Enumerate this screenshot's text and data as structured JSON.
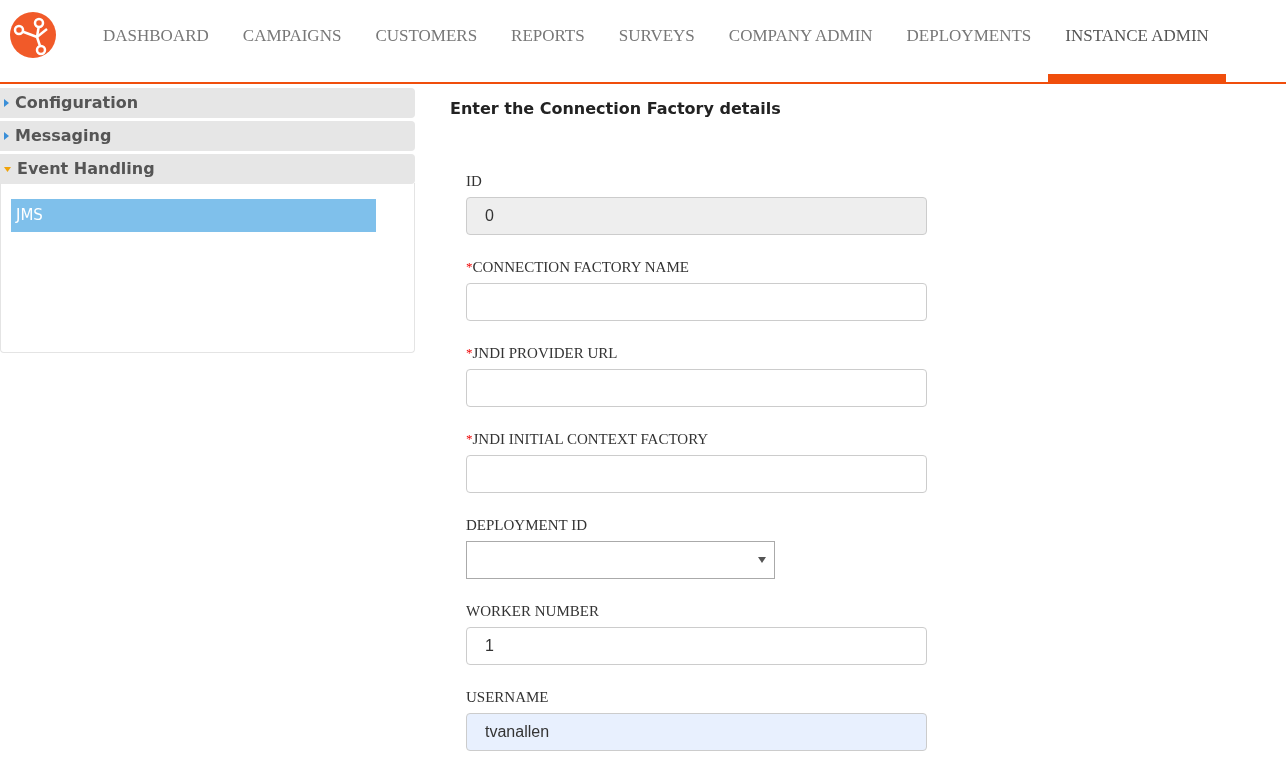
{
  "nav": {
    "items": [
      {
        "label": "DASHBOARD",
        "selected": false
      },
      {
        "label": "CAMPAIGNS",
        "selected": false
      },
      {
        "label": "CUSTOMERS",
        "selected": false
      },
      {
        "label": "REPORTS",
        "selected": false
      },
      {
        "label": "SURVEYS",
        "selected": false
      },
      {
        "label": "COMPANY ADMIN",
        "selected": false
      },
      {
        "label": "DEPLOYMENTS",
        "selected": false
      },
      {
        "label": "INSTANCE ADMIN",
        "selected": true
      }
    ]
  },
  "sidebar": {
    "sections": [
      {
        "label": "Configuration",
        "expanded": false
      },
      {
        "label": "Messaging",
        "expanded": false
      },
      {
        "label": "Event Handling",
        "expanded": true,
        "children": [
          {
            "label": "JMS",
            "selected": true
          }
        ]
      }
    ]
  },
  "form": {
    "title": "Enter the Connection Factory details",
    "required_mark": "*",
    "fields": [
      {
        "kind": "text",
        "label": "ID",
        "required": false,
        "value": "0",
        "disabled": true,
        "autofilled": false
      },
      {
        "kind": "text",
        "label": "CONNECTION FACTORY NAME",
        "required": true,
        "disabled": false,
        "autofilled": false
      },
      {
        "kind": "text",
        "label": "JNDI PROVIDER URL",
        "required": true,
        "disabled": false,
        "autofilled": false
      },
      {
        "kind": "text",
        "label": "JNDI INITIAL CONTEXT FACTORY",
        "required": true,
        "disabled": false,
        "autofilled": false
      },
      {
        "kind": "select",
        "label": "DEPLOYMENT ID",
        "required": false,
        "disabled": false,
        "autofilled": false
      },
      {
        "kind": "text",
        "label": "WORKER NUMBER",
        "required": false,
        "value": "1",
        "disabled": false,
        "autofilled": false
      },
      {
        "kind": "text",
        "label": "USERNAME",
        "required": false,
        "value": "tvanallen",
        "disabled": false,
        "autofilled": true
      }
    ]
  }
}
